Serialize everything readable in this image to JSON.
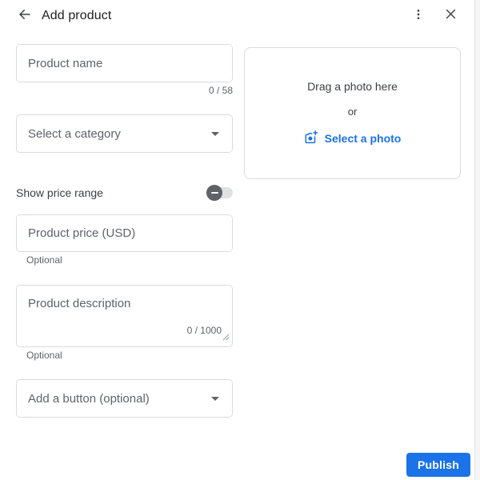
{
  "header": {
    "title": "Add product",
    "back_icon": "arrow-back",
    "more_icon": "kebab-menu",
    "close_icon": "close-x"
  },
  "form": {
    "product_name": {
      "placeholder": "Product name",
      "counter": "0 / 58"
    },
    "category": {
      "value": "Select a category"
    },
    "price_toggle": {
      "label": "Show price range",
      "state": "off"
    },
    "price": {
      "placeholder": "Product price (USD)",
      "helper": "Optional"
    },
    "description": {
      "placeholder": "Product description",
      "counter": "0 / 1000",
      "helper": "Optional"
    },
    "action_button": {
      "value": "Add a button (optional)"
    }
  },
  "photo_upload": {
    "drag_text": "Drag a photo here",
    "or_text": "or",
    "select_label": "Select a photo",
    "icon": "add-a-photo"
  },
  "footer": {
    "publish_label": "Publish"
  },
  "colors": {
    "accent_blue": "#1a73e8",
    "border_gray": "#dadce0",
    "text_primary": "#202124",
    "text_secondary": "#5f6368",
    "toggle_thumb": "#5f6368",
    "toggle_track": "#dfe1e5"
  }
}
